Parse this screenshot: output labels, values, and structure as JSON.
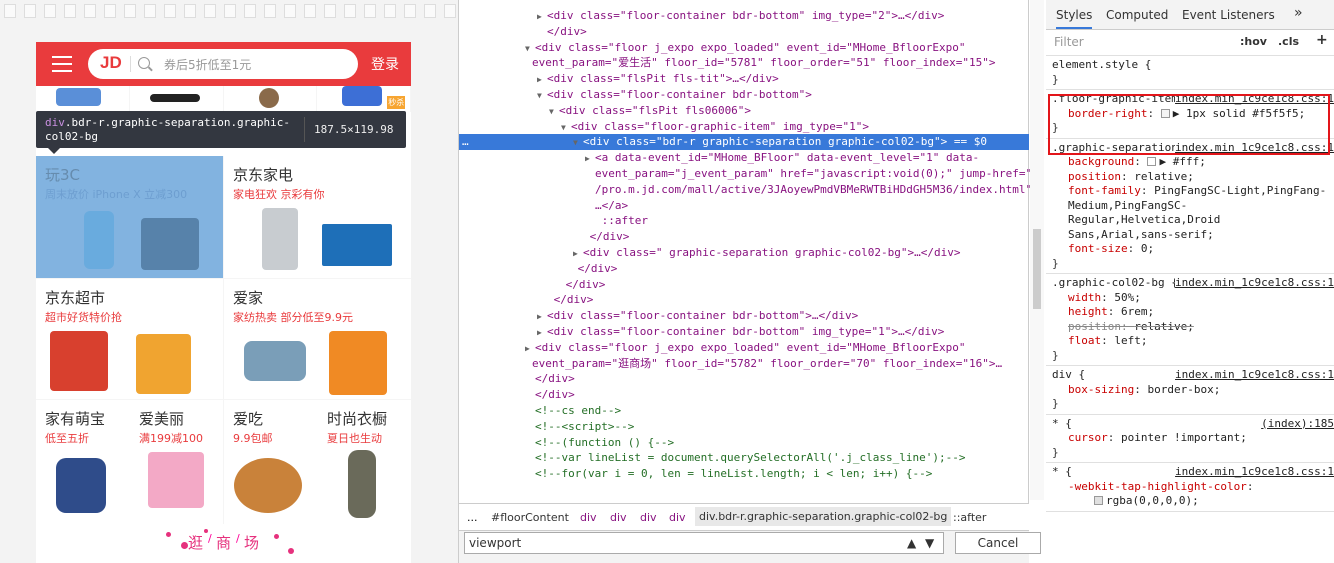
{
  "mobile": {
    "logo": "JD",
    "search_placeholder": "券后5折低至1元",
    "login": "登录",
    "cells": [
      {
        "title": "玩3C",
        "sub": "周末放价 iPhone X 立减300"
      },
      {
        "title": "京东家电",
        "sub": "家电狂欢 京彩有你"
      },
      {
        "title": "京东超市",
        "sub": "超市好货特价抢"
      },
      {
        "title": "爱家",
        "sub": "家纺热卖 部分低至9.9元"
      },
      {
        "title": "家有萌宝",
        "sub": "低至五折"
      },
      {
        "title": "爱美丽",
        "sub": "满199减100"
      },
      {
        "title": "爱吃",
        "sub": "9.9包邮"
      },
      {
        "title": "时尚衣橱",
        "sub": "夏日也生动"
      }
    ],
    "footer_chars": [
      "逛",
      "/",
      "商",
      "/",
      "场"
    ],
    "badge": "秒杀"
  },
  "tooltip": {
    "tag": "div",
    "selector": ".bdr-r.graphic-separation.graphic-col02-bg",
    "size": "187.5×119.98"
  },
  "elements_panel": {
    "lines": [
      {
        "indent": 1,
        "tri": "▶",
        "text": "<div class=\"floor-container bdr-bottom\" img_type=\"2\">…</div>"
      },
      {
        "indent": 1,
        "tri": "",
        "text": "</div>"
      },
      {
        "indent": 0,
        "tri": "▼",
        "text": "<div class=\"floor j_expo expo_loaded\" event_id=\"MHome_BfloorExpo\""
      },
      {
        "indent": -1,
        "tri": "",
        "text": "event_param=\"爱生活\" floor_id=\"5781\" floor_order=\"51\" floor_index=\"15\">"
      },
      {
        "indent": 1,
        "tri": "▶",
        "text": "<div class=\"flsPit fls-tit\">…</div>"
      },
      {
        "indent": 1,
        "tri": "▼",
        "text": "<div class=\"floor-container bdr-bottom\">"
      },
      {
        "indent": 2,
        "tri": "▼",
        "text": "<div class=\"flsPit fls06006\">"
      },
      {
        "indent": 3,
        "tri": "▼",
        "text": "<div class=\"floor-graphic-item\" img_type=\"1\">"
      },
      {
        "indent": 4,
        "tri": "▼",
        "text": "<div class=\"bdr-r graphic-separation  graphic-col02-bg\"> == $0",
        "selected": true
      },
      {
        "indent": 5,
        "tri": "▶",
        "text": "<a data-event_id=\"MHome_BFloor\" data-event_level=\"1\" data-"
      },
      {
        "indent": 5,
        "tri": "",
        "text": "event_param=\"j_event_param\" href=\"javascript:void(0);\" jump-href=\"/"
      },
      {
        "indent": 5,
        "tri": "",
        "text": "/pro.m.jd.com/mall/active/3JAoyewPmdVBMeRWTBiHDdGH5M36/index.html\">"
      },
      {
        "indent": 5,
        "tri": "",
        "text": "…</a>"
      },
      {
        "indent": 5,
        "tri": "",
        "text": "  ::after"
      },
      {
        "indent": 4,
        "tri": "",
        "text": "  </div>"
      },
      {
        "indent": 4,
        "tri": "▶",
        "text": "<div class=\" graphic-separation  graphic-col02-bg\">…</div>"
      },
      {
        "indent": 3,
        "tri": "",
        "text": "  </div>"
      },
      {
        "indent": 2,
        "tri": "",
        "text": "  </div>"
      },
      {
        "indent": 1,
        "tri": "",
        "text": "  </div>"
      },
      {
        "indent": 1,
        "tri": "▶",
        "text": "<div class=\"floor-container bdr-bottom\">…</div>"
      },
      {
        "indent": 1,
        "tri": "▶",
        "text": "<div class=\"floor-container bdr-bottom\" img_type=\"1\">…</div>"
      },
      {
        "indent": 0,
        "tri": "▶",
        "text": "<div class=\"floor j_expo expo_loaded\" event_id=\"MHome_BfloorExpo\""
      },
      {
        "indent": -1,
        "tri": "",
        "text": "event_param=\"逛商场\" floor_id=\"5782\" floor_order=\"70\" floor_index=\"16\">…"
      },
      {
        "indent": 0,
        "tri": "",
        "text": "</div>"
      },
      {
        "indent": 0,
        "tri": "",
        "text": "</div>"
      },
      {
        "indent": 0,
        "tri": "",
        "text": "<!--cs end-->",
        "comment": true
      },
      {
        "indent": 0,
        "tri": "",
        "text": "<!--<script>-->",
        "comment": true
      },
      {
        "indent": 0,
        "tri": "",
        "text": "<!--(function () {-->",
        "comment": true
      },
      {
        "indent": 0,
        "tri": "",
        "text": "<!--var lineList = document.querySelectorAll('.j_class_line');-->",
        "comment": true
      },
      {
        "indent": 0,
        "tri": "",
        "text": "<!--for(var i = 0, len = lineList.length; i < len; i++) {-->",
        "comment": true
      }
    ],
    "breadcrumbs": [
      "...",
      "#floorContent",
      "div",
      "div",
      "div",
      "div",
      "div.bdr-r.graphic-separation.graphic-col02-bg",
      "::after"
    ],
    "find_value": "viewport",
    "find_cancel": "Cancel"
  },
  "styles_panel": {
    "tabs": [
      "Styles",
      "Computed",
      "Event Listeners",
      "»"
    ],
    "filter_placeholder": "Filter",
    "hov": ":hov",
    "cls": ".cls",
    "plus": "+",
    "rules": [
      {
        "selector": "element.style {",
        "source": "",
        "props": [],
        "close": "}"
      },
      {
        "selector": ".floor-graphic-item .bdr-r {",
        "source": "index.min_1c9ce1c8.css:1",
        "props": [
          {
            "n": "border-right",
            "v": "▶ 1px solid #f5f5f5;",
            "swatch": "#f5f5f5"
          }
        ],
        "close": "}"
      },
      {
        "selector": ".graphic-separation {",
        "source": "index.min_1c9ce1c8.css:1",
        "props": [
          {
            "n": "background",
            "v": "▶ #fff;",
            "swatch": "#ffffff"
          },
          {
            "n": "position",
            "v": "relative;"
          },
          {
            "n": "font-family",
            "v": "PingFangSC-Light,PingFang-Medium,PingFangSC-Regular,Helvetica,Droid Sans,Arial,sans-serif;"
          },
          {
            "n": "font-size",
            "v": "0;"
          }
        ],
        "close": "}"
      },
      {
        "selector": ".graphic-col02-bg {",
        "source": "index.min_1c9ce1c8.css:1",
        "props": [
          {
            "n": "width",
            "v": "50%;"
          },
          {
            "n": "height",
            "v": "6rem;"
          },
          {
            "n": "position",
            "v": "relative;",
            "strike": true
          },
          {
            "n": "float",
            "v": "left;"
          }
        ],
        "close": "}"
      },
      {
        "selector": "div {",
        "source": "index.min_1c9ce1c8.css:1",
        "props": [
          {
            "n": "box-sizing",
            "v": "border-box;"
          }
        ],
        "close": "}"
      },
      {
        "selector": "* {",
        "source": "(index):185",
        "props": [
          {
            "n": "cursor",
            "v": "pointer !important;"
          }
        ],
        "close": "}"
      },
      {
        "selector": "* {",
        "source": "index.min_1c9ce1c8.css:1",
        "props": [
          {
            "n": "-webkit-tap-highlight-color",
            "v": ""
          },
          {
            "n": "",
            "v": "rgba(0,0,0,0);",
            "swatch": "#e0e0e0"
          }
        ],
        "close": ""
      }
    ]
  }
}
